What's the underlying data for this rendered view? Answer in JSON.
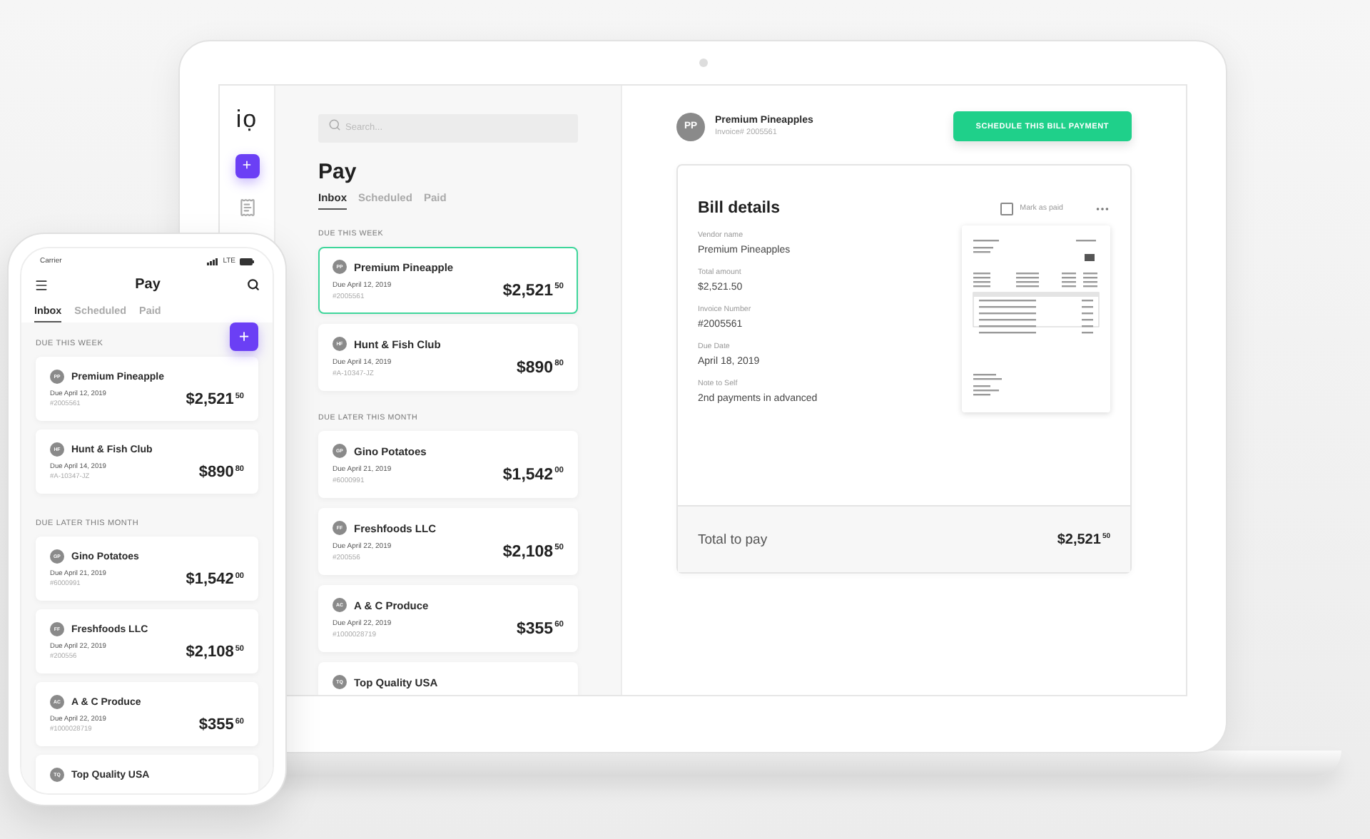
{
  "laptop": {
    "sidebar": {
      "logo": "iọ",
      "add_button": "+"
    },
    "search": {
      "placeholder": "Search..."
    },
    "title": "Pay",
    "tabs": [
      {
        "label": "Inbox",
        "selected": true
      },
      {
        "label": "Scheduled",
        "selected": false
      },
      {
        "label": "Paid",
        "selected": false
      }
    ],
    "sections": [
      {
        "heading": "DUE THIS WEEK",
        "bills": [
          {
            "initials": "PP",
            "vendor": "Premium Pineapple",
            "due": "Due April 12, 2019",
            "number": "#2005561",
            "amount": "$2,521$^{50}$",
            "selected": true
          },
          {
            "initials": "HF",
            "vendor": "Hunt & Fish Club",
            "due": "Due April 14, 2019",
            "number": "#A-10347-JZ",
            "amount": "$890$^{80}$",
            "selected": false
          }
        ]
      },
      {
        "heading": "DUE LATER THIS MONTH",
        "bills": [
          {
            "initials": "GP",
            "vendor": "Gino Potatoes",
            "due": "Due April 21, 2019",
            "number": "#6000991",
            "amount": "$1,542$^{00}$",
            "selected": false
          },
          {
            "initials": "FF",
            "vendor": "Freshfoods LLC",
            "due": "Due April 22, 2019",
            "number": "#200556",
            "amount": "$2,108$^{50}$",
            "selected": false
          },
          {
            "initials": "AC",
            "vendor": "A & C Produce",
            "due": "Due April 22, 2019",
            "number": "#1000028719",
            "amount": "$355$^{60}$",
            "selected": false
          },
          {
            "initials": "TQ",
            "vendor": "Top Quality USA",
            "selected": false
          }
        ]
      }
    ],
    "detail": {
      "initials": "PP",
      "vendor": "Premium Pineapples",
      "invoice": "Invoice# 2005561",
      "action": "SCHEDULE THIS BILL PAYMENT",
      "card_title": "Bill details",
      "mark_paid": {
        "label": "Mark as paid",
        "checked": false
      },
      "fields": [
        {
          "label": "Vendor name",
          "value": "Premium Pineapples"
        },
        {
          "label": "Total amount",
          "value": "$2,521.50"
        },
        {
          "label": "Invoice Number",
          "value": "#2005561"
        },
        {
          "label": "Due Date",
          "value": "April 18, 2019"
        },
        {
          "label": "Note to Self",
          "value": "2nd payments in advanced"
        }
      ],
      "total": {
        "label": "Total to pay",
        "amount": "$2,521$^{50}$"
      }
    }
  },
  "phone": {
    "status": {
      "carrier": "Carrier",
      "network": "LTE"
    },
    "title": "Pay",
    "tabs": [
      {
        "label": "Inbox",
        "selected": true
      },
      {
        "label": "Scheduled",
        "selected": false
      },
      {
        "label": "Paid",
        "selected": false
      }
    ],
    "add_button": "+",
    "sections": [
      {
        "heading": "DUE THIS WEEK",
        "bills": [
          {
            "initials": "PP",
            "vendor": "Premium Pineapple",
            "due": "Due April 12, 2019",
            "number": "#2005561",
            "amount": "$2,521$^{50}$"
          },
          {
            "initials": "HF",
            "vendor": "Hunt & Fish Club",
            "due": "Due April 14, 2019",
            "number": "#A-10347-JZ",
            "amount": "$890$^{80}$"
          }
        ]
      },
      {
        "heading": "DUE LATER THIS MONTH",
        "bills": [
          {
            "initials": "GP",
            "vendor": "Gino Potatoes",
            "due": "Due April 21, 2019",
            "number": "#6000991",
            "amount": "$1,542$^{00}$"
          },
          {
            "initials": "FF",
            "vendor": "Freshfoods LLC",
            "due": "Due April 22, 2019",
            "number": "#200556",
            "amount": "$2,108$^{50}$"
          },
          {
            "initials": "AC",
            "vendor": "A & C Produce",
            "due": "Due April 22, 2019",
            "number": "#1000028719",
            "amount": "$355$^{60}$"
          },
          {
            "initials": "TQ",
            "vendor": "Top Quality USA"
          }
        ]
      }
    ]
  }
}
